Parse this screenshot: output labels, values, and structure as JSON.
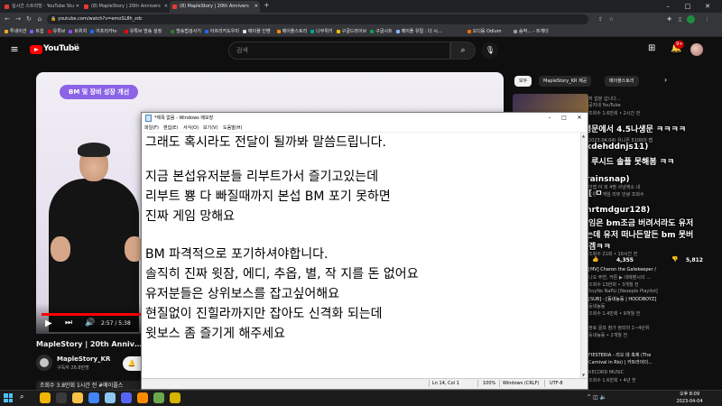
{
  "browser": {
    "tabs": [
      {
        "label": "실시간 스트리밍 - YouTube Stu"
      },
      {
        "label": "(8) MapleStory | 20th Annivers"
      },
      {
        "label": "(8) MapleStory | 20th Annivers"
      }
    ],
    "new_tab": "+",
    "url": "youtube.com/watch?v=emoSL8h_zdc",
    "bookmarks": [
      {
        "label": "투네이션",
        "color": "#f5a623"
      },
      {
        "label": "트윕",
        "color": "#7b61ff"
      },
      {
        "label": "유튜브",
        "color": "#ff0000"
      },
      {
        "label": "트위치",
        "color": "#9146ff"
      },
      {
        "label": "아프리카tv",
        "color": "#1b6cff"
      },
      {
        "label": "유튜브 방송 설정",
        "color": "#ff0000"
      },
      {
        "label": "방송법검사기",
        "color": "#2e7d32"
      },
      {
        "label": "아프리카도우미",
        "color": "#1b6cff"
      },
      {
        "label": "메이플 인벤",
        "color": "#e0e0e0"
      },
      {
        "label": "메이플스토리",
        "color": "#ff8a00"
      },
      {
        "label": "나무위키",
        "color": "#00a495"
      },
      {
        "label": "구글드라이브",
        "color": "#fbbc04"
      },
      {
        "label": "구글시트",
        "color": "#0f9d58"
      },
      {
        "label": "메이플 유틸 : 다 시...",
        "color": "#8ab4f8"
      },
      {
        "label": "오디움 Odium",
        "color": "#ff6d00"
      },
      {
        "label": "숨작... - 트게더",
        "color": "#9e9e9e"
      }
    ]
  },
  "youtube": {
    "logo_word": "YouTube",
    "logo_region": "KR",
    "search_placeholder": "검색",
    "notification_count": "9+",
    "video": {
      "banner": "BM 및 장비 성장 개선",
      "time": "2:57 / 5:38",
      "progress_fraction": 0.46,
      "title": "MapleStory | 20th Anniversar",
      "channel": "MapleStory_KR",
      "subs": "구독자 26.8만명",
      "views": "조회수 3.8만회 1시간 전 #메이플스"
    },
    "chips": [
      {
        "label": "모두",
        "active": true
      },
      {
        "label": "MapleStory_KR 제공",
        "active": false
      },
      {
        "label": "메이플스토리",
        "active": false
      }
    ],
    "recs": [
      {
        "title": "저 없분 갑니다...",
        "meta": "공지네 YouTube"
      },
      {
        "title": "",
        "meta": "조회수 1.6만회 • 2시간 전"
      },
      {
        "title": "",
        "meta": "2023.04.04) 유니온 5100의 맵"
      },
      {
        "title": "",
        "meta": "조회수 1.8만회 • 2시간 전"
      },
      {
        "title": "",
        "meta": "미접 이 외 4명 사냥캐소 내"
      },
      {
        "title": "",
        "meta": "유튜브 게임 리뷰 안녕 조회수"
      },
      {
        "title": "",
        "meta": "조회수 21회 • 10시간 전"
      },
      {
        "title": "[MV] Charon the Gatekeeper /",
        "meta": "나오 주연, 커튼 ▶ 대에벤시의 ..."
      },
      {
        "title": "",
        "meta": "조회수 13만회 • 3개월 전"
      },
      {
        "title": "",
        "meta": "SoyNo NaPLi [Nexeple Playlist]"
      },
      {
        "title": "[SUB] - [동네농동 | HOODBOYZ]",
        "meta": "동네농동"
      },
      {
        "title": "",
        "meta": "조회수 1.4만회 • 9개월 전"
      },
      {
        "title": "",
        "meta": "볼로 골프 참가 정되라 1~4단위"
      },
      {
        "title": "",
        "meta": "동네농동 • 2개월 전"
      },
      {
        "title": "FIESTERIA - 리오 데 축제 (The",
        "meta": ""
      },
      {
        "title": "Carnival in Rio) | 카트라이더...",
        "meta": "RECORD MUSIC"
      },
      {
        "title": "",
        "meta": "조회수 1.6만회 • 4년 전"
      }
    ],
    "chat_overlay": [
      "5중나생문에서 4.5나생문 ㅋㅋㅋㅋ",
      "변조(rkdehddnjs11)",
      "나 아직 루시드 솔플 못해봄 ㅋㅋ",
      "닉도_(rainsnap)",
      "원소의 [ ㅁ",
      "류엄(rnrtmdgur128)",
      "다른 게임은 bm조금 버려서라도 유저",
      "잡으려는데 유저 떠나든말든 bm 못버",
      "리는 갓겜ㅋㅋ"
    ],
    "stats": [
      {
        "icon": "like",
        "value": "4,355"
      },
      {
        "icon": "dislike",
        "value": "5,812"
      }
    ]
  },
  "notepad": {
    "title": "*제목 없음 - Windows 메모장",
    "menu": [
      "파일(F)",
      "편집(E)",
      "서식(O)",
      "보기(V)",
      "도움말(H)"
    ],
    "lines": [
      "그래도 혹시라도 전달이 될까봐 말씀드립니다.",
      "",
      "지금 본섭유저분들 리부트가서 즐기고있는데",
      "리부트 뿅 다 빠질때까지 본섭 BM 포기 못하면",
      "진짜 게임 망해요",
      "",
      "BM 파격적으로 포기하셔야합니다.",
      "솔직히 진짜 윗잠, 에디, 추옵, 별, 작 지를 돈 없어요",
      "유저분들은 상위보스를 잡고싶어해요",
      "현질없이 진힐라까지만 잡아도 신격화 되는데",
      "윗보스 좀 즐기게 해주세요"
    ],
    "status": {
      "position": "Ln 14, Col 1",
      "zoom": "100%",
      "eol": "Windows (CRLF)",
      "encoding": "UTF-8"
    }
  },
  "taskbar": {
    "time": "오후 8:09",
    "date": "2023-04-04",
    "apps": [
      {
        "name": "chrome",
        "color": "#f2b600"
      },
      {
        "name": "obs",
        "color": "#3a3a3a"
      },
      {
        "name": "folder",
        "color": "#f6c144"
      },
      {
        "name": "chrome-2",
        "color": "#4285f4"
      },
      {
        "name": "notepad",
        "color": "#8ec5f0"
      },
      {
        "name": "discord",
        "color": "#5865f2"
      },
      {
        "name": "maple",
        "color": "#ff8a00"
      },
      {
        "name": "game",
        "color": "#6aa84f"
      },
      {
        "name": "app",
        "color": "#d7b400"
      }
    ]
  }
}
